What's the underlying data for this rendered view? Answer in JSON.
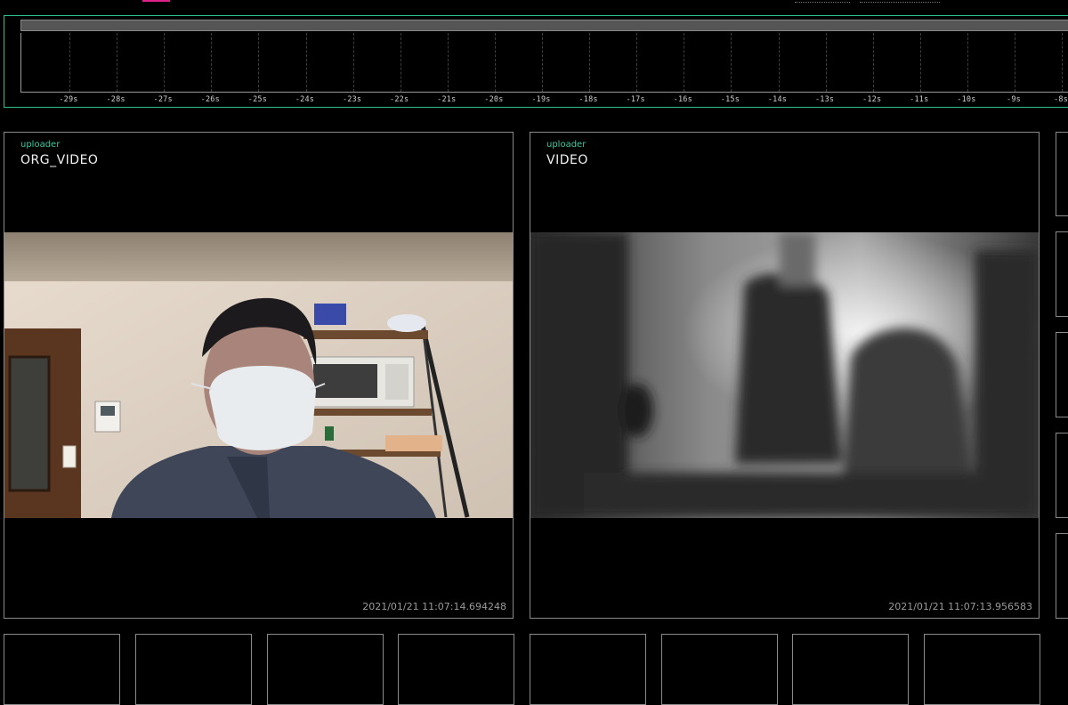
{
  "timeline": {
    "ticks": [
      "-29s",
      "-28s",
      "-27s",
      "-26s",
      "-25s",
      "-24s",
      "-23s",
      "-22s",
      "-21s",
      "-20s",
      "-19s",
      "-18s",
      "-17s",
      "-16s",
      "-15s",
      "-14s",
      "-13s",
      "-12s",
      "-11s",
      "-10s",
      "-9s",
      "-8s"
    ]
  },
  "panels": [
    {
      "source": "uploader",
      "name": "ORG_VIDEO",
      "timestamp": "2021/01/21 11:07:14.694248"
    },
    {
      "source": "uploader",
      "name": "VIDEO",
      "timestamp": "2021/01/21 11:07:13.956583"
    }
  ],
  "colors": {
    "accent": "#2fbf8f",
    "source_label": "#38c9a0",
    "tab_highlight": "#e0218a",
    "panel_border": "#8a8a8a"
  }
}
